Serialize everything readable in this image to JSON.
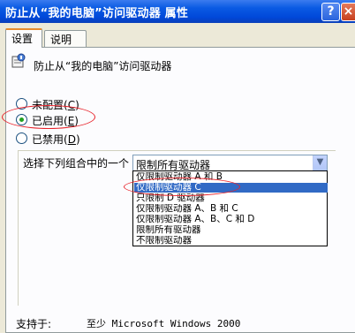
{
  "window": {
    "title": "防止从“我的电脑”访问驱动器 属性",
    "help_glyph": "?",
    "close_glyph": "×",
    "colors": {
      "titlebar": "#0a5ae3",
      "accent_tab": "#e68b2c",
      "selection": "#316ac5",
      "annotation": "#e8222a"
    }
  },
  "tabs": [
    {
      "label": "设置",
      "active": true
    },
    {
      "label": "说明",
      "active": false
    }
  ],
  "policy": {
    "icon": "policy-setting-icon",
    "name": "防止从“我的电脑”访问驱动器"
  },
  "options": [
    {
      "label": "未配置",
      "accel": "C",
      "checked": false
    },
    {
      "label": "已启用",
      "accel": "E",
      "checked": true
    },
    {
      "label": "已禁用",
      "accel": "D",
      "checked": false
    }
  ],
  "combo": {
    "label": "选择下列组合中的一个",
    "value": "限制所有驱动器",
    "arrow_icon": "chevron-down-icon",
    "items": [
      "仅限制驱动器 A 和 B",
      "仅限制驱动器 C",
      "只限制 D 驱动器",
      "仅限制驱动器 A、B 和 C",
      "仅限制驱动器 A、B、C 和 D",
      "限制所有驱动器",
      "不限制驱动器"
    ],
    "selected_index": 1
  },
  "supported": {
    "label": "支持于:",
    "value": "至少 Microsoft Windows 2000"
  }
}
